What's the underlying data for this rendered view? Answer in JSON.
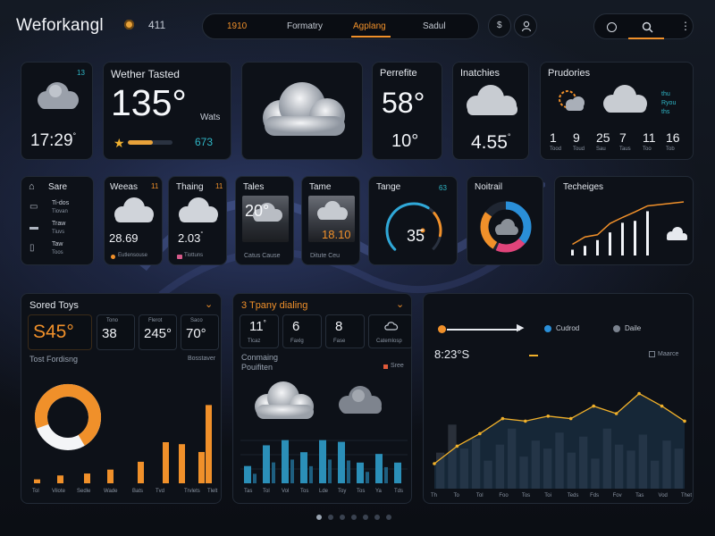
{
  "topbar": {
    "brand": "Weforkangl",
    "badge_icon": "coin-icon",
    "count": "411",
    "nav": [
      {
        "label": "1910",
        "active": true
      },
      {
        "label": "Formatry",
        "active": false
      },
      {
        "label": "Agplang",
        "active": true
      },
      {
        "label": "Sadul",
        "active": false
      }
    ],
    "right_icons": [
      "circle-icon",
      "search-icon",
      "more-icon"
    ]
  },
  "row1": {
    "card1": {
      "badge": "13",
      "time": "17:29",
      "time_suffix": "°"
    },
    "card2": {
      "title": "Wether Tasted",
      "temp": "135°",
      "unit": "Wats",
      "teal_value": "673",
      "progress": 0.55
    },
    "card4": {
      "title": "Perrefite",
      "temp": "58°",
      "low": "10°"
    },
    "card5": {
      "title": "Inatchies",
      "value": "4.55",
      "value_suffix": "°"
    },
    "card6": {
      "title": "Prudories",
      "side_labels": [
        "thu",
        "Ryou",
        "ths"
      ],
      "forecast": [
        {
          "v": "1",
          "sub": "Tood"
        },
        {
          "v": "9",
          "sub": "Toud"
        },
        {
          "v": "25",
          "sub": "Sau"
        },
        {
          "v": "7",
          "sub": "Taus"
        },
        {
          "v": "11",
          "sub": "Too"
        },
        {
          "v": "16",
          "sub": "Tob"
        }
      ]
    }
  },
  "row2": {
    "sidebar": {
      "title": "Sare",
      "items": [
        {
          "icon": "folder-icon",
          "l1": "Ti-dos",
          "l2": "Tiovan"
        },
        {
          "icon": "car-icon",
          "l1": "Traw",
          "l2": "Tiuvs"
        },
        {
          "icon": "device-icon",
          "l1": "Taw",
          "l2": "Toos"
        }
      ]
    },
    "tile1": {
      "title": "Weeas",
      "flag": "11",
      "value": "28.69",
      "sub": "Eutlensouse"
    },
    "tile2": {
      "title": "Thaing",
      "flag": "11",
      "value": "2.03",
      "value_suffix": "°",
      "sub": "Tiottuns"
    },
    "tile3": {
      "title": "Tales",
      "value": "20°",
      "sub": "Catus Cause"
    },
    "tile4": {
      "title": "Tame",
      "value": "18.10",
      "sub": "Ditute Ceu"
    },
    "tile5": {
      "title": "Tange",
      "flag": "63",
      "value": "35",
      "value_prefix": "3",
      "gauge": 0.62
    },
    "tile6": {
      "title": "Noitrail"
    },
    "tile7": {
      "title": "Techeiges",
      "bars": [
        3,
        5,
        8,
        12,
        17,
        18,
        23
      ]
    }
  },
  "panel1": {
    "title": "Sored Toys",
    "big": "S45°",
    "stats": [
      {
        "label": "Tono",
        "value": "38"
      },
      {
        "label": "Flerot",
        "value": "245°"
      },
      {
        "label": "Saco",
        "value": "70°"
      }
    ],
    "section": "Tost Fordisng",
    "link": "Bosstaver",
    "donut": 0.72,
    "chart_data": {
      "type": "bar",
      "categories": [
        "Tol",
        "Vilote",
        "Sedle",
        "Wade",
        "Bats",
        "Tvd",
        "Trvlets",
        "Rlso",
        "Tlelt"
      ],
      "values": [
        2,
        4,
        5,
        7,
        11,
        21,
        20,
        16,
        40
      ],
      "ylim": [
        0,
        42
      ]
    }
  },
  "panel2": {
    "title": "3 Tpany dialing",
    "stats": [
      {
        "value": "11",
        "suffix": "°",
        "label": "Tlcaz"
      },
      {
        "value": "6",
        "label": "Faxlg"
      },
      {
        "value": "8",
        "label": "Fase"
      },
      {
        "value": "",
        "label": "Catemlosp",
        "icon": "cloud-icon"
      }
    ],
    "section": "Conmaing",
    "subsection": "Pouifiten",
    "badge": "Sree",
    "chart_data": {
      "type": "bar",
      "categories": [
        "Tas",
        "Tol",
        "Vol",
        "Tos",
        "Lde",
        "Toy",
        "Tos",
        "Ya",
        "Tds"
      ],
      "values": [
        10,
        22,
        25,
        18,
        25,
        24,
        12,
        17,
        12
      ],
      "ylim": [
        0,
        30
      ]
    }
  },
  "panel3": {
    "legend": [
      {
        "label": "Cudrod",
        "color": "#2a8fd8"
      },
      {
        "label": "Daile",
        "color": "#7a828e"
      }
    ],
    "time": "8:23°S",
    "legend2": "Maarce",
    "chart_data": {
      "type": "line",
      "categories": [
        "Th",
        "To",
        "Tol",
        "Foo",
        "Tos",
        "Toi",
        "Teds",
        "Fds",
        "Fov",
        "Tas",
        "Vod",
        "Thet"
      ],
      "values": [
        10,
        17,
        22,
        28,
        27,
        29,
        28,
        33,
        30,
        38,
        33,
        27
      ],
      "bars": [
        18,
        32,
        20,
        25,
        14,
        22,
        30,
        16,
        24,
        20,
        28,
        18,
        26,
        15,
        30,
        22,
        19,
        27,
        14,
        24,
        20
      ],
      "ylim": [
        0,
        45
      ]
    }
  },
  "pager": {
    "count": 7,
    "active": 0
  },
  "colors": {
    "accent": "#f0902a",
    "teal": "#2fb6c6",
    "bar_blue": "#2b8fb8"
  }
}
